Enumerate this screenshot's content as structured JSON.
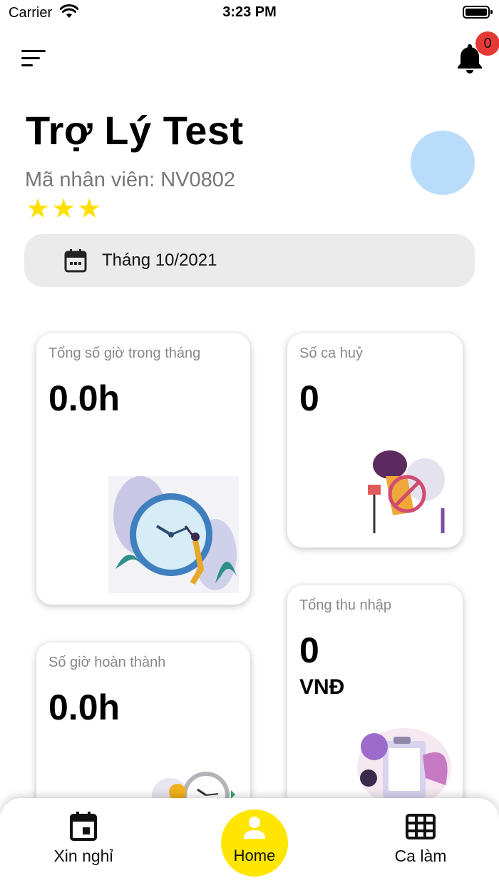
{
  "status_bar": {
    "carrier": "Carrier",
    "time": "3:23 PM"
  },
  "header": {
    "notification_count": "0"
  },
  "profile": {
    "name": "Trợ Lý Test",
    "employee_code": "Mã nhân viên: NV0802",
    "rating": 3,
    "stars": "★★★"
  },
  "month_picker": {
    "label": "Tháng 10/2021"
  },
  "cards": {
    "total_hours": {
      "title": "Tổng số giờ trong tháng",
      "value": "0.0h"
    },
    "cancelled_shifts": {
      "title": "Số ca huỷ",
      "value": "0"
    },
    "completed_hours": {
      "title": "Số giờ hoàn thành",
      "value": "0.0h"
    },
    "total_income": {
      "title": "Tổng thu nhập",
      "value": "0",
      "unit": "VNĐ"
    }
  },
  "tabbar": {
    "leave": "Xin nghỉ",
    "home": "Home",
    "shifts": "Ca làm"
  },
  "colors": {
    "accent_yellow": "#ffe600",
    "star_yellow": "#ffe000",
    "badge_red": "#e53935",
    "avatar_blue": "#b9dcfa",
    "picker_bg": "#ebebeb"
  },
  "icons": [
    "wifi-icon",
    "battery-icon",
    "menu-icon",
    "bell-icon",
    "calendar-icon",
    "calendar-day-icon",
    "person-icon",
    "grid-icon"
  ]
}
